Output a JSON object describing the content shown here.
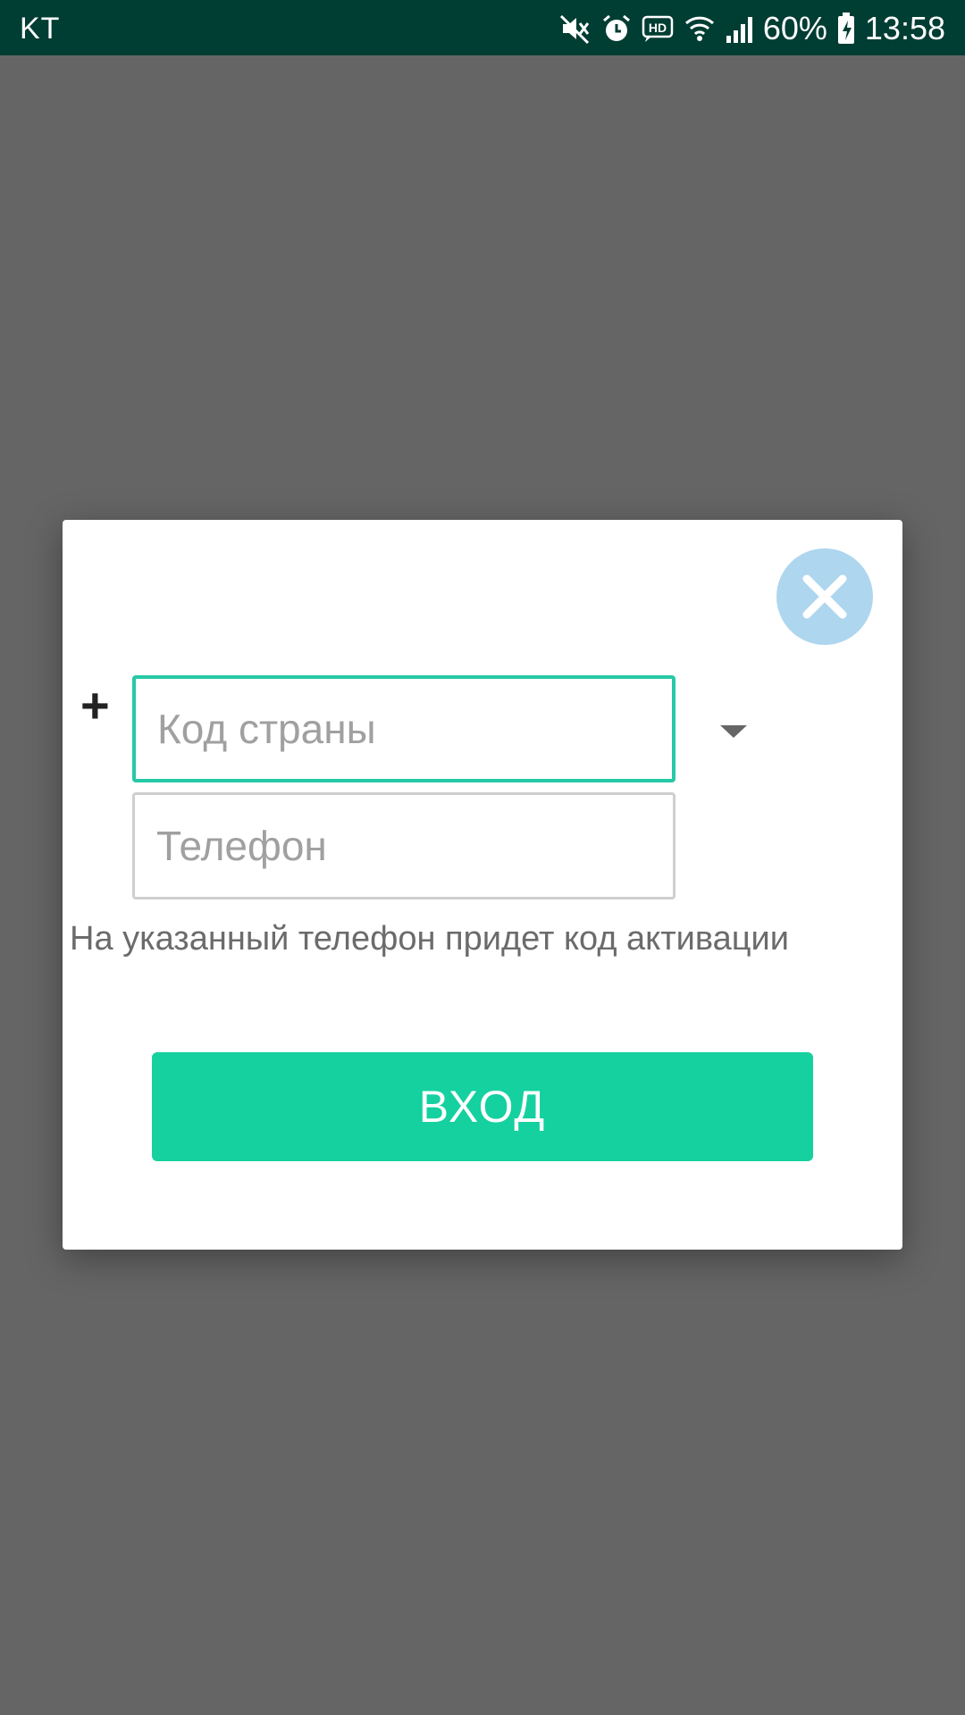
{
  "status_bar": {
    "carrier": "KT",
    "battery": "60%",
    "time": "13:58",
    "icons": [
      "mute-icon",
      "alarm-icon",
      "hd-voice-icon",
      "wifi-icon",
      "signal-icon",
      "battery-charging-icon"
    ]
  },
  "dialog": {
    "close_icon": "close-icon",
    "plus_label": "+",
    "country_code_placeholder": "Код страны",
    "phone_placeholder": "Телефон",
    "hint": "На указанный телефон придет код активации",
    "login_label": "ВХОД"
  },
  "colors": {
    "status_bar_bg": "#003d33",
    "overlay": "#656565",
    "accent": "#14d19f",
    "focus_border": "#26c9a6",
    "close_button": "#aed6ef"
  }
}
